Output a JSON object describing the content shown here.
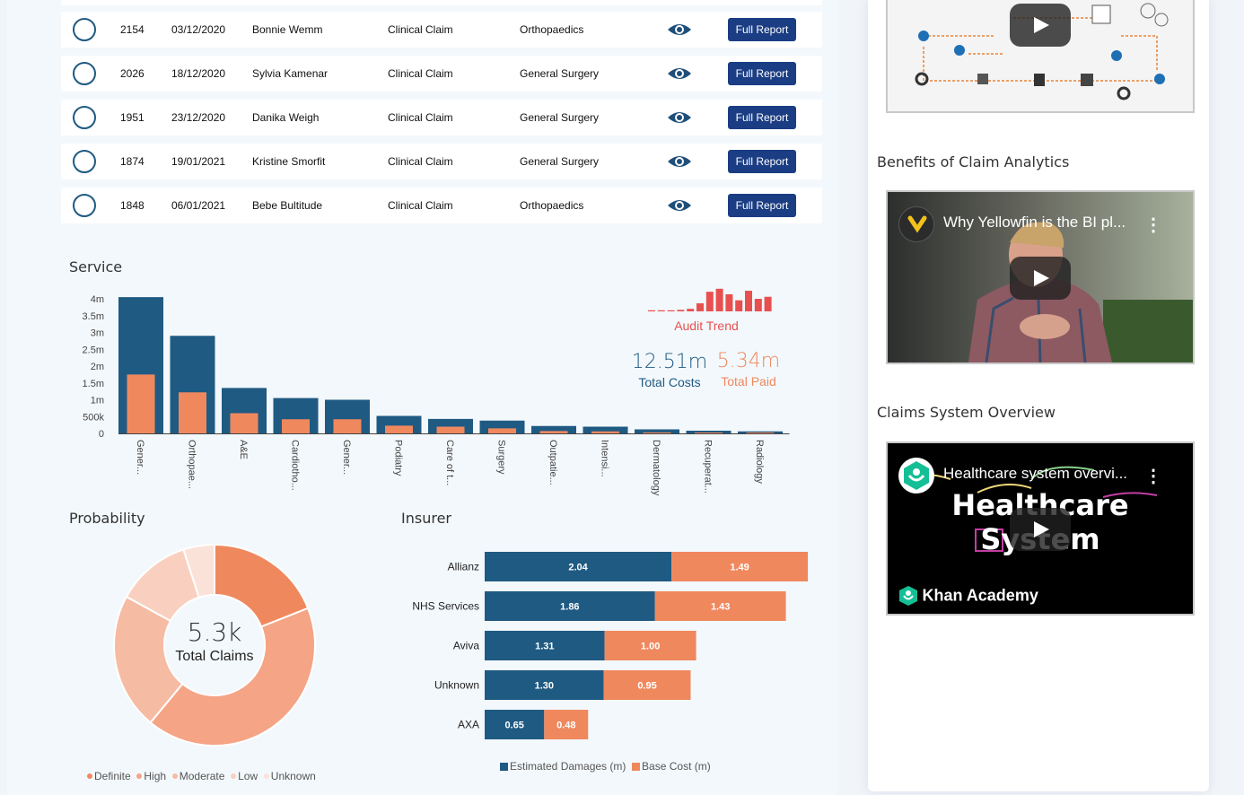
{
  "table": {
    "button_label": "Full Report",
    "rows": [
      {
        "id": "2154",
        "date": "03/12/2020",
        "name": "Bonnie Wemm",
        "type": "Clinical Claim",
        "service": "Orthopaedics"
      },
      {
        "id": "2026",
        "date": "18/12/2020",
        "name": "Sylvia Kamenar",
        "type": "Clinical Claim",
        "service": "General Surgery"
      },
      {
        "id": "1951",
        "date": "23/12/2020",
        "name": "Danika Weigh",
        "type": "Clinical Claim",
        "service": "General Surgery"
      },
      {
        "id": "1874",
        "date": "19/01/2021",
        "name": "Kristine Smorfit",
        "type": "Clinical Claim",
        "service": "General Surgery"
      },
      {
        "id": "1848",
        "date": "06/01/2021",
        "name": "Bebe Bultitude",
        "type": "Clinical Claim",
        "service": "Orthopaedics"
      }
    ]
  },
  "service": {
    "title": "Service",
    "audit_label": "Audit Trend",
    "total_costs_value": "12.51m",
    "total_costs_label": "Total Costs",
    "total_paid_value": "5.34m",
    "total_paid_label": "Total Paid",
    "audit_trend": [
      0.04,
      0.04,
      0.02,
      0.06,
      0.1,
      0.32,
      0.78,
      0.9,
      0.68,
      0.44,
      0.82,
      0.5,
      0.58,
      1.0
    ]
  },
  "probability": {
    "title": "Probability",
    "center_value": "5.3k",
    "center_label": "Total Claims",
    "legend": [
      "Definite",
      "High",
      "Moderate",
      "Low",
      "Unknown"
    ]
  },
  "insurer": {
    "title": "Insurer",
    "legend": [
      "Estimated Damages (m)",
      "Base Cost (m)"
    ]
  },
  "sidebar": {
    "section_benefits": "Benefits of Claim Analytics",
    "section_overview": "Claims System Overview",
    "video1_title": "Why Yellowfin is the BI pl...",
    "video2_title": "Healthcare system overvi...",
    "video2_big_line1": "Healthcare",
    "video2_big_line2": "System",
    "video2_brand": "Khan Academy"
  },
  "colors": {
    "navy": "#1f5a82",
    "orange": "#f0885e",
    "button": "#1b3d84",
    "audit": "#e8504f",
    "prob": [
      "#f0885e",
      "#f5a485",
      "#f6bba3",
      "#f9d0bf",
      "#fbe2d8"
    ]
  },
  "chart_data": [
    {
      "type": "bar",
      "title": "Service",
      "categories": [
        "Gener...",
        "Orthopae...",
        "A&E",
        "Cardiotho...",
        "Gener...",
        "Podiatry",
        "Care of t...",
        "Surgery",
        "Outpatie...",
        "Intensi...",
        "Dermatology",
        "Recuperat...",
        "Radiology"
      ],
      "ytick_labels": [
        "0",
        "500k",
        "1m",
        "1.5m",
        "2m",
        "2.5m",
        "3m",
        "3.5m",
        "4m"
      ],
      "ylim": [
        0,
        4000000
      ],
      "series": [
        {
          "values": [
            4050000,
            2900000,
            1350000,
            1050000,
            1000000,
            520000,
            430000,
            380000,
            220000,
            200000,
            120000,
            80000,
            60000
          ]
        },
        {
          "values": [
            1750000,
            1220000,
            600000,
            420000,
            420000,
            230000,
            200000,
            150000,
            70000,
            60000,
            30000,
            20000,
            15000
          ]
        }
      ],
      "grid": false
    },
    {
      "type": "pie",
      "title": "Probability",
      "labels": [
        "Definite",
        "High",
        "Moderate",
        "Low",
        "Unknown"
      ],
      "values": [
        0.19,
        0.42,
        0.22,
        0.12,
        0.05
      ]
    },
    {
      "type": "bar",
      "title": "Insurer",
      "orientation": "horizontal",
      "stacked": true,
      "categories": [
        "Allianz",
        "NHS Services",
        "Aviva",
        "Unknown",
        "AXA"
      ],
      "series": [
        {
          "name": "Estimated Damages (m)",
          "values": [
            2.04,
            1.86,
            1.31,
            1.3,
            0.65
          ]
        },
        {
          "name": "Base Cost (m)",
          "values": [
            1.49,
            1.43,
            1.0,
            0.95,
            0.48
          ]
        }
      ],
      "legend": "bottom"
    }
  ]
}
